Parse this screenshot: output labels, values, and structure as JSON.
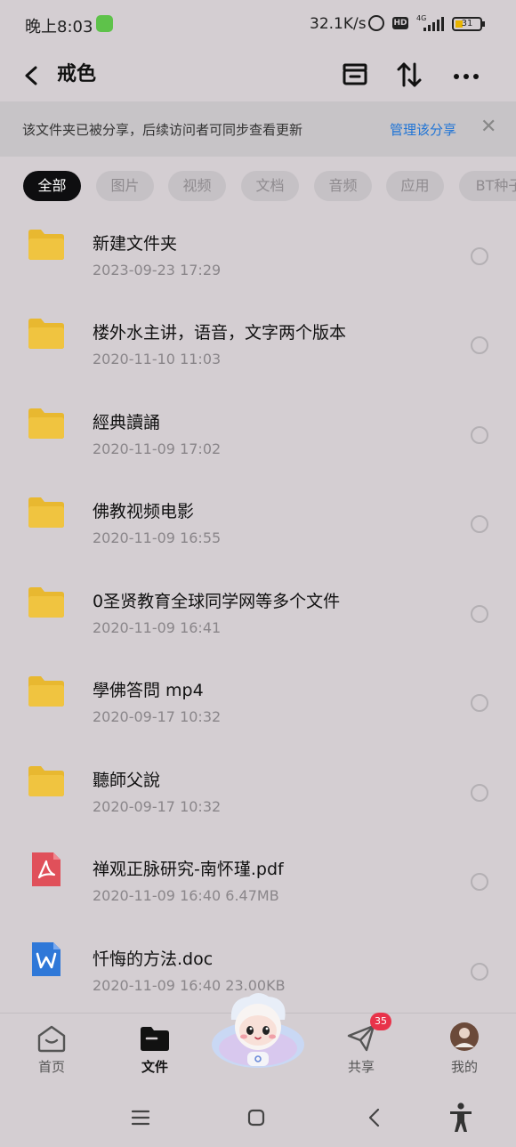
{
  "status_bar": {
    "time": "晚上8:03",
    "net_speed": "32.1K/s",
    "hd_label": "HD",
    "network_label": "4G",
    "battery": "31",
    "icons": [
      "wechat-icon",
      "alarm-icon",
      "hd-icon",
      "signal-icon",
      "battery-icon"
    ]
  },
  "header": {
    "title": "戒色",
    "icons": [
      "back-icon",
      "archive-icon",
      "sort-icon",
      "more-icon"
    ]
  },
  "share_banner": {
    "message": "该文件夹已被分享，后续访问者可同步查看更新",
    "manage_label": "管理该分享",
    "close_label": "✕"
  },
  "filters": {
    "items": [
      "全部",
      "图片",
      "视频",
      "文档",
      "音频",
      "应用",
      "BT种子"
    ],
    "selected": "全部"
  },
  "files": [
    {
      "name": "新建文件夹",
      "date": "2023-09-23  17:29",
      "type": "folder"
    },
    {
      "name": "楼外水主讲，语音，文字两个版本",
      "date": "2020-11-10  11:03",
      "type": "folder"
    },
    {
      "name": "經典讀誦",
      "date": "2020-11-09  17:02",
      "type": "folder"
    },
    {
      "name": "佛教视频电影",
      "date": "2020-11-09  16:55",
      "type": "folder"
    },
    {
      "name": "0圣贤教育全球同学网等多个文件",
      "date": "2020-11-09  16:41",
      "type": "folder"
    },
    {
      "name": "學佛答問 mp4",
      "date": "2020-09-17  10:32",
      "type": "folder"
    },
    {
      "name": "聽師父說",
      "date": "2020-09-17  10:32",
      "type": "folder"
    },
    {
      "name": "禅观正脉研究-南怀瑾.pdf",
      "date": "2020-11-09  16:40   6.47MB",
      "type": "pdf"
    },
    {
      "name": "忏悔的方法.doc",
      "date": "2020-11-09  16:40   23.00KB",
      "type": "doc"
    }
  ],
  "tabbar": {
    "items": [
      {
        "label": "首页",
        "icon": "home-icon"
      },
      {
        "label": "文件",
        "icon": "folder-icon"
      },
      {
        "label": "共享",
        "icon": "share-icon"
      },
      {
        "label": "我的",
        "icon": "avatar"
      }
    ],
    "selected": "文件",
    "share_badge": "35",
    "mascot": "mascot-icon"
  },
  "system_nav": {
    "icons": [
      "menu-icon",
      "home-square-icon",
      "back-arrow-icon",
      "accessibility-icon"
    ]
  },
  "colors": {
    "background": "#d4ced2",
    "accent_link": "#1f74d6",
    "folder": "#e8b830",
    "pdf": "#e0505a",
    "doc": "#2f78d8",
    "badge": "#e8334a"
  }
}
